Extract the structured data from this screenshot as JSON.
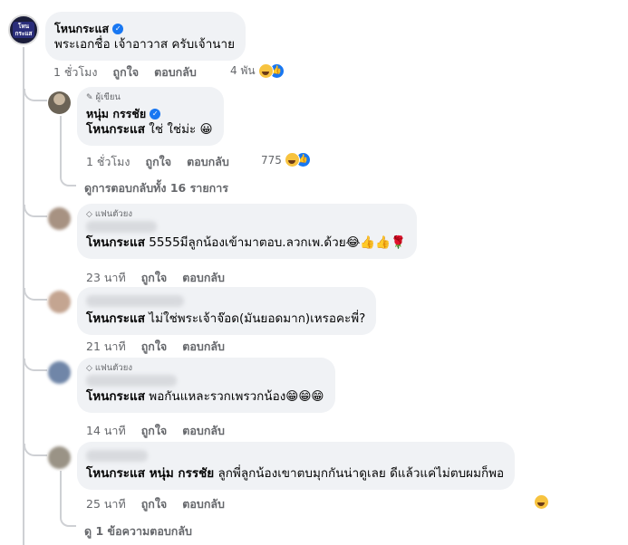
{
  "page_author": "โหนกระแส",
  "avatar_logo_text": "โหน กระแส",
  "top_comment": {
    "author": "โหนกระแส",
    "text": "พระเอกชื่อ เจ้าอาวาส ครับเจ้านาย",
    "time": "1 ชั่วโมง",
    "like": "ถูกใจ",
    "reply": "ตอบกลับ",
    "reaction_count": "4 พัน",
    "reactions": [
      "haha-icon",
      "like-icon"
    ]
  },
  "author_reply": {
    "badge": "ผู้เขียน",
    "author": "หนุ่ม กรรชัย",
    "mention": "โหนกระแส",
    "text": "ใช่ ใช่ม่ะ 😀",
    "time": "1 ชั่วโมง",
    "like": "ถูกใจ",
    "reply": "ตอบกลับ",
    "reaction_count": "775"
  },
  "view_all_replies": "ดูการตอบกลับทั้ง 16 รายการ",
  "comments": [
    {
      "badge": "แฟนตัวยง",
      "mention": "โหนกระแส",
      "text": "5555มีลูกน้องเข้ามาตอบ.ลวกเพ.ด้วย😂👍👍🌹",
      "time": "23 นาที",
      "like": "ถูกใจ",
      "reply": "ตอบกลับ"
    },
    {
      "badge": "",
      "mention": "โหนกระแส",
      "text": "ไม่ใช่พระเจ้าจ๊อด(มันยอดมาก)เหรอคะพี่?",
      "time": "21 นาที",
      "like": "ถูกใจ",
      "reply": "ตอบกลับ"
    },
    {
      "badge": "แฟนตัวยง",
      "mention": "โหนกระแส",
      "text": "พอกันแหละรวกเพรวกน้อง😁😁😁",
      "time": "14 นาที",
      "like": "ถูกใจ",
      "reply": "ตอบกลับ"
    },
    {
      "badge": "",
      "mention": "โหนกระแส หนุ่ม กรรชัย",
      "text": "ลูกพี่ลูกน้องเขาตบมุกกันน่าดูเลย ดีแล้วแค่ไม่ตบผมก็พอ",
      "time": "25 นาที",
      "like": "ถูกใจ",
      "reply": "ตอบกลับ"
    }
  ],
  "view_one_reply": "ดู 1 ข้อความตอบกลับ",
  "colors": {
    "bubble": "#f0f2f5",
    "secondary_text": "#65676b",
    "like_blue": "#1877f2",
    "haha_yellow": "#f7c33f"
  }
}
